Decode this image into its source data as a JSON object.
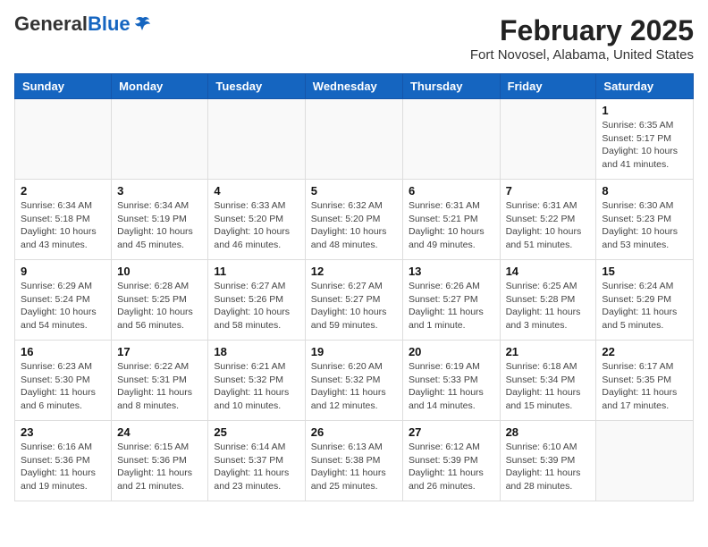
{
  "header": {
    "logo_general": "General",
    "logo_blue": "Blue",
    "month": "February 2025",
    "location": "Fort Novosel, Alabama, United States"
  },
  "days_of_week": [
    "Sunday",
    "Monday",
    "Tuesday",
    "Wednesday",
    "Thursday",
    "Friday",
    "Saturday"
  ],
  "weeks": [
    [
      {
        "day": "",
        "info": ""
      },
      {
        "day": "",
        "info": ""
      },
      {
        "day": "",
        "info": ""
      },
      {
        "day": "",
        "info": ""
      },
      {
        "day": "",
        "info": ""
      },
      {
        "day": "",
        "info": ""
      },
      {
        "day": "1",
        "info": "Sunrise: 6:35 AM\nSunset: 5:17 PM\nDaylight: 10 hours\nand 41 minutes."
      }
    ],
    [
      {
        "day": "2",
        "info": "Sunrise: 6:34 AM\nSunset: 5:18 PM\nDaylight: 10 hours\nand 43 minutes."
      },
      {
        "day": "3",
        "info": "Sunrise: 6:34 AM\nSunset: 5:19 PM\nDaylight: 10 hours\nand 45 minutes."
      },
      {
        "day": "4",
        "info": "Sunrise: 6:33 AM\nSunset: 5:20 PM\nDaylight: 10 hours\nand 46 minutes."
      },
      {
        "day": "5",
        "info": "Sunrise: 6:32 AM\nSunset: 5:20 PM\nDaylight: 10 hours\nand 48 minutes."
      },
      {
        "day": "6",
        "info": "Sunrise: 6:31 AM\nSunset: 5:21 PM\nDaylight: 10 hours\nand 49 minutes."
      },
      {
        "day": "7",
        "info": "Sunrise: 6:31 AM\nSunset: 5:22 PM\nDaylight: 10 hours\nand 51 minutes."
      },
      {
        "day": "8",
        "info": "Sunrise: 6:30 AM\nSunset: 5:23 PM\nDaylight: 10 hours\nand 53 minutes."
      }
    ],
    [
      {
        "day": "9",
        "info": "Sunrise: 6:29 AM\nSunset: 5:24 PM\nDaylight: 10 hours\nand 54 minutes."
      },
      {
        "day": "10",
        "info": "Sunrise: 6:28 AM\nSunset: 5:25 PM\nDaylight: 10 hours\nand 56 minutes."
      },
      {
        "day": "11",
        "info": "Sunrise: 6:27 AM\nSunset: 5:26 PM\nDaylight: 10 hours\nand 58 minutes."
      },
      {
        "day": "12",
        "info": "Sunrise: 6:27 AM\nSunset: 5:27 PM\nDaylight: 10 hours\nand 59 minutes."
      },
      {
        "day": "13",
        "info": "Sunrise: 6:26 AM\nSunset: 5:27 PM\nDaylight: 11 hours\nand 1 minute."
      },
      {
        "day": "14",
        "info": "Sunrise: 6:25 AM\nSunset: 5:28 PM\nDaylight: 11 hours\nand 3 minutes."
      },
      {
        "day": "15",
        "info": "Sunrise: 6:24 AM\nSunset: 5:29 PM\nDaylight: 11 hours\nand 5 minutes."
      }
    ],
    [
      {
        "day": "16",
        "info": "Sunrise: 6:23 AM\nSunset: 5:30 PM\nDaylight: 11 hours\nand 6 minutes."
      },
      {
        "day": "17",
        "info": "Sunrise: 6:22 AM\nSunset: 5:31 PM\nDaylight: 11 hours\nand 8 minutes."
      },
      {
        "day": "18",
        "info": "Sunrise: 6:21 AM\nSunset: 5:32 PM\nDaylight: 11 hours\nand 10 minutes."
      },
      {
        "day": "19",
        "info": "Sunrise: 6:20 AM\nSunset: 5:32 PM\nDaylight: 11 hours\nand 12 minutes."
      },
      {
        "day": "20",
        "info": "Sunrise: 6:19 AM\nSunset: 5:33 PM\nDaylight: 11 hours\nand 14 minutes."
      },
      {
        "day": "21",
        "info": "Sunrise: 6:18 AM\nSunset: 5:34 PM\nDaylight: 11 hours\nand 15 minutes."
      },
      {
        "day": "22",
        "info": "Sunrise: 6:17 AM\nSunset: 5:35 PM\nDaylight: 11 hours\nand 17 minutes."
      }
    ],
    [
      {
        "day": "23",
        "info": "Sunrise: 6:16 AM\nSunset: 5:36 PM\nDaylight: 11 hours\nand 19 minutes."
      },
      {
        "day": "24",
        "info": "Sunrise: 6:15 AM\nSunset: 5:36 PM\nDaylight: 11 hours\nand 21 minutes."
      },
      {
        "day": "25",
        "info": "Sunrise: 6:14 AM\nSunset: 5:37 PM\nDaylight: 11 hours\nand 23 minutes."
      },
      {
        "day": "26",
        "info": "Sunrise: 6:13 AM\nSunset: 5:38 PM\nDaylight: 11 hours\nand 25 minutes."
      },
      {
        "day": "27",
        "info": "Sunrise: 6:12 AM\nSunset: 5:39 PM\nDaylight: 11 hours\nand 26 minutes."
      },
      {
        "day": "28",
        "info": "Sunrise: 6:10 AM\nSunset: 5:39 PM\nDaylight: 11 hours\nand 28 minutes."
      },
      {
        "day": "",
        "info": ""
      }
    ]
  ]
}
